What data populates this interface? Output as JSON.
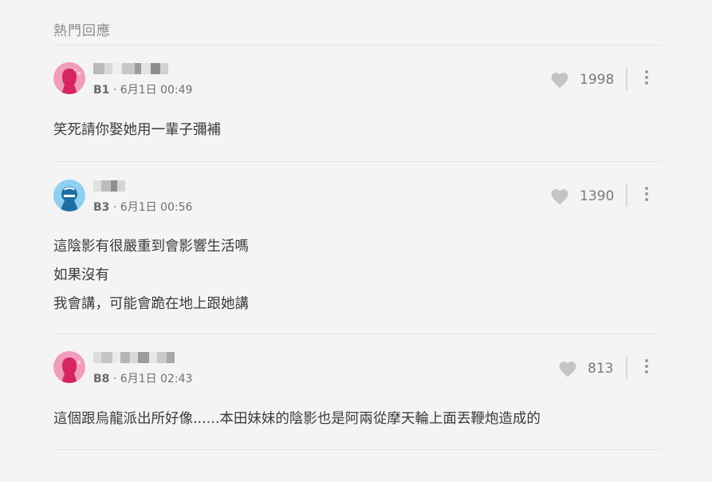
{
  "section": {
    "title": "熱門回應"
  },
  "comments": [
    {
      "floor": "B1",
      "time": "6月1日 00:49",
      "likes": "1998",
      "avatar": "female",
      "lines": [
        "笑死請你娶她用一輩子彌補"
      ]
    },
    {
      "floor": "B3",
      "time": "6月1日 00:56",
      "likes": "1390",
      "avatar": "male",
      "lines": [
        "這陰影有很嚴重到會影響生活嗎",
        "如果沒有",
        "我會講，可能會跪在地上跟她講"
      ]
    },
    {
      "floor": "B8",
      "time": "6月1日 02:43",
      "likes": "813",
      "avatar": "female",
      "lines": [
        "這個跟烏龍派出所好像......本田妹妹的陰影也是阿兩從摩天輪上面丟鞭炮造成的"
      ]
    }
  ],
  "colors": {
    "female_avatar": "#f19bbd",
    "female_figure": "#d5265e",
    "male_avatar": "#8fd0f2",
    "male_figure": "#1f6fa6"
  },
  "icons": {
    "like": "heart-icon",
    "more": "more-vertical-icon"
  }
}
